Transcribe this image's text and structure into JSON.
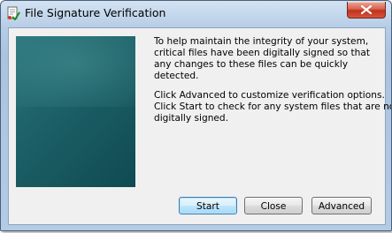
{
  "window": {
    "title": "File Signature Verification",
    "icon": "signature-check-icon"
  },
  "titlebar": {
    "close_icon": "close-icon",
    "close_color": "#c9432f"
  },
  "content": {
    "intro": "To help maintain the integrity of your system, critical files have been digitally signed so that any changes to these files can be quickly detected.",
    "help_line1": "Click Advanced to customize verification options.",
    "help_line2": "Click Start to check for any system files that are not digitally signed."
  },
  "panel": {
    "color": "#1c5f66"
  },
  "buttons": {
    "start": "Start",
    "close": "Close",
    "advanced": "Advanced"
  }
}
